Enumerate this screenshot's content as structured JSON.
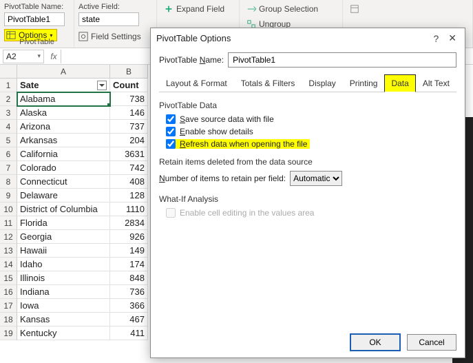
{
  "ribbon": {
    "pivot_name_label": "PivotTable Name:",
    "pivot_name_value": "PivotTable1",
    "options_btn": "Options",
    "group_pivot": "PivotTable",
    "active_field_label": "Active Field:",
    "active_field_value": "state",
    "field_settings": "Field Settings",
    "expand_field": "Expand Field",
    "group_selection": "Group Selection",
    "ungroup": "Ungroup"
  },
  "namebox": "A2",
  "grid": {
    "col_a": "A",
    "col_b": "B",
    "headers": {
      "state": "Sate",
      "count": "Count"
    },
    "rows": [
      {
        "n": 2,
        "state": "Alabama",
        "count": 738
      },
      {
        "n": 3,
        "state": "Alaska",
        "count": 146
      },
      {
        "n": 4,
        "state": "Arizona",
        "count": 737
      },
      {
        "n": 5,
        "state": "Arkansas",
        "count": 204
      },
      {
        "n": 6,
        "state": "California",
        "count": 3631
      },
      {
        "n": 7,
        "state": "Colorado",
        "count": 742
      },
      {
        "n": 8,
        "state": "Connecticut",
        "count": 408
      },
      {
        "n": 9,
        "state": "Delaware",
        "count": 128
      },
      {
        "n": 10,
        "state": "District of Columbia",
        "count": 1110
      },
      {
        "n": 11,
        "state": "Florida",
        "count": 2834
      },
      {
        "n": 12,
        "state": "Georgia",
        "count": 926
      },
      {
        "n": 13,
        "state": "Hawaii",
        "count": 149
      },
      {
        "n": 14,
        "state": "Idaho",
        "count": 174
      },
      {
        "n": 15,
        "state": "Illinois",
        "count": 848
      },
      {
        "n": 16,
        "state": "Indiana",
        "count": 736
      },
      {
        "n": 17,
        "state": "Iowa",
        "count": 366
      },
      {
        "n": 18,
        "state": "Kansas",
        "count": 467
      },
      {
        "n": 19,
        "state": "Kentucky",
        "count": 411
      }
    ]
  },
  "dialog": {
    "title": "PivotTable Options",
    "name_label": "PivotTable Name:",
    "name_value": "PivotTable1",
    "tabs": {
      "layout": "Layout & Format",
      "totals": "Totals & Filters",
      "display": "Display",
      "printing": "Printing",
      "data": "Data",
      "alttext": "Alt Text"
    },
    "section_data": "PivotTable Data",
    "chk_save": "Save source data with file",
    "chk_details": "Enable show details",
    "chk_refresh": "Refresh data when opening the file",
    "section_retain": "Retain items deleted from the data source",
    "retain_label": "Number of items to retain per field:",
    "retain_value": "Automatic",
    "section_whatif": "What-If Analysis",
    "chk_whatif": "Enable cell editing in the values area",
    "ok": "OK",
    "cancel": "Cancel"
  }
}
